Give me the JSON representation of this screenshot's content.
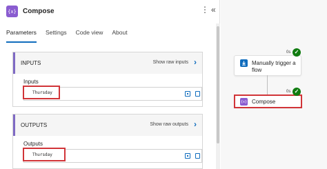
{
  "panel": {
    "title": "Compose",
    "app_icon_glyph": "{x}",
    "menu_glyph": "⋮",
    "collapse_glyph": "«",
    "tabs": [
      {
        "label": "Parameters",
        "active": true
      },
      {
        "label": "Settings",
        "active": false
      },
      {
        "label": "Code view",
        "active": false
      },
      {
        "label": "About",
        "active": false
      }
    ]
  },
  "inputs_section": {
    "title": "INPUTS",
    "raw_link": "Show raw inputs",
    "field_label": "Inputs",
    "value": "Thursday"
  },
  "outputs_section": {
    "title": "OUTPUTS",
    "raw_link": "Show raw outputs",
    "field_label": "Outputs",
    "value": "Thursday"
  },
  "canvas": {
    "trigger_node": {
      "label_line1": "Manually trigger a",
      "label_line2": "flow",
      "duration": "0s",
      "status": "succeeded"
    },
    "compose_node": {
      "label": "Compose",
      "duration": "0s",
      "status": "succeeded",
      "selected": true
    }
  },
  "colors": {
    "accent": "#0f6cbd",
    "compose_icon": "#8a5cd0",
    "trigger_icon": "#0f6cbd",
    "success": "#107c10",
    "highlight": "#d13438"
  }
}
